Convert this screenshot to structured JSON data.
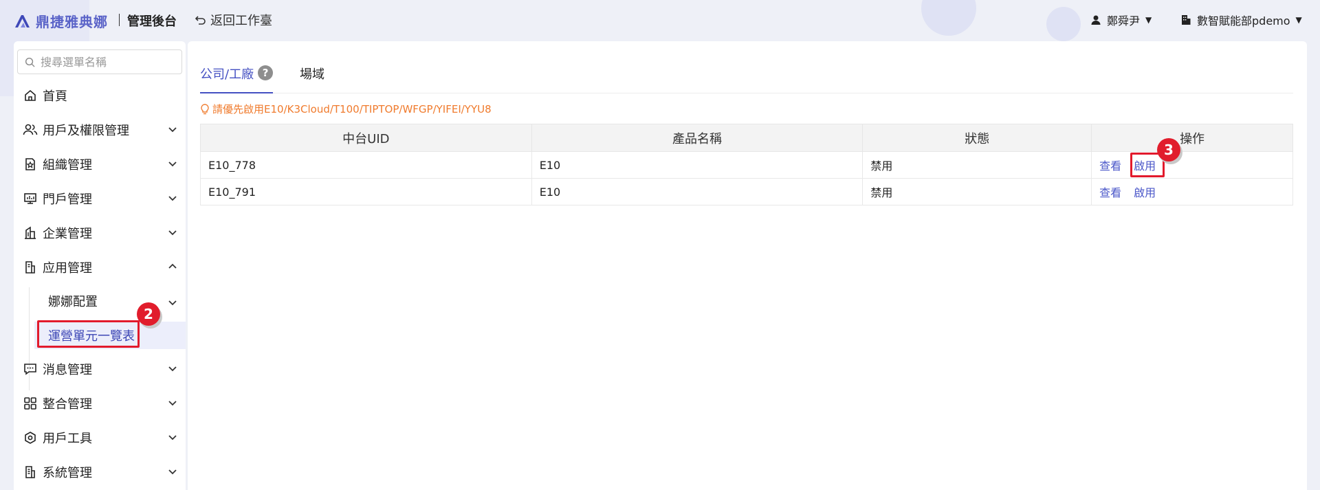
{
  "header": {
    "logo_text": "鼎捷雅典娜",
    "admin_title": "管理後台",
    "back_label": "返回工作臺",
    "user_name": "鄭舜尹",
    "org_name": "數智賦能部pdemo"
  },
  "sidebar": {
    "search_placeholder": "搜尋選單名稱",
    "items": [
      {
        "label": "首頁",
        "icon": "home-icon"
      },
      {
        "label": "用戶及權限管理",
        "icon": "users-icon"
      },
      {
        "label": "組織管理",
        "icon": "org-icon"
      },
      {
        "label": "門戶管理",
        "icon": "monitor-icon"
      },
      {
        "label": "企業管理",
        "icon": "building-icon"
      },
      {
        "label": "应用管理",
        "icon": "document-icon"
      },
      {
        "label": "消息管理",
        "icon": "message-icon"
      },
      {
        "label": "整合管理",
        "icon": "grid-icon"
      },
      {
        "label": "用戶工具",
        "icon": "hexagon-icon"
      },
      {
        "label": "系統管理",
        "icon": "system-icon"
      }
    ],
    "sub_items": [
      {
        "label": "娜娜配置"
      },
      {
        "label": "運營單元一覽表"
      }
    ]
  },
  "annotations": {
    "step2": "2",
    "step3": "3"
  },
  "main": {
    "tabs": [
      {
        "label": "公司/工廠"
      },
      {
        "label": "場域"
      }
    ],
    "help_mark": "?",
    "tip": "請優先啟用E10/K3Cloud/T100/TIPTOP/WFGP/YIFEI/YYU8",
    "table": {
      "headers": [
        "中台UID",
        "產品名稱",
        "狀態",
        "操作"
      ],
      "rows": [
        {
          "uid": "E10_778",
          "product": "E10",
          "status": "禁用",
          "view": "查看",
          "enable": "啟用"
        },
        {
          "uid": "E10_791",
          "product": "E10",
          "status": "禁用",
          "view": "查看",
          "enable": "啟用"
        }
      ]
    }
  },
  "colors": {
    "accent": "#4450c2",
    "tip": "#f07b2d",
    "annotation": "#e11d2c"
  }
}
